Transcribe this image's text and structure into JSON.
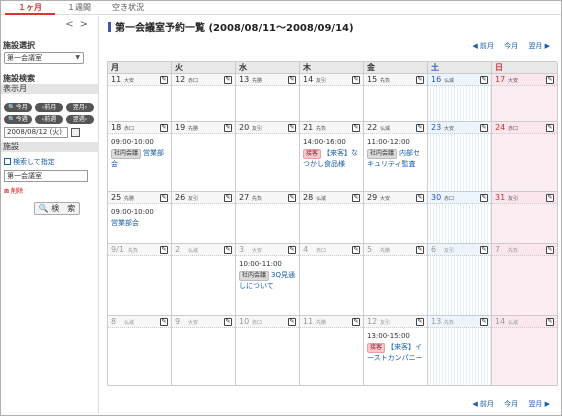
{
  "tabs": [
    "１ヶ月",
    "１週間",
    "空き状況"
  ],
  "sidebar": {
    "facility_select_heading": "施設選択",
    "facility_select_value": "第一会議室",
    "facility_search_heading": "施設検索",
    "display_month_label": "表示月",
    "today_button": "今月",
    "prev_month_button": "前月",
    "next_month_button": "翌月",
    "today_week_button": "今週",
    "prev_week_button": "前週",
    "next_week_button": "翌週",
    "date_value": "2008/08/12 (火)",
    "facility_label": "施設",
    "search_link": "検索して指定",
    "facility_input_value": "第一会議室",
    "delete_label": "削除",
    "search_button": "検　索"
  },
  "main": {
    "title": "第一会議室予約一覧 (2008/08/11～2008/09/14)",
    "pager_prev": "◀ 前月",
    "pager_current": "今月",
    "pager_next": "翌月 ▶"
  },
  "weekdays": [
    "月",
    "火",
    "水",
    "木",
    "金",
    "土",
    "日"
  ],
  "weeks": [
    [
      {
        "day": "11",
        "rokuyo": "大安",
        "events": []
      },
      {
        "day": "12",
        "rokuyo": "赤口",
        "events": []
      },
      {
        "day": "13",
        "rokuyo": "先勝",
        "events": []
      },
      {
        "day": "14",
        "rokuyo": "友引",
        "events": []
      },
      {
        "day": "15",
        "rokuyo": "先負",
        "events": []
      },
      {
        "day": "16",
        "rokuyo": "仏滅",
        "events": []
      },
      {
        "day": "17",
        "rokuyo": "大安",
        "events": []
      }
    ],
    [
      {
        "day": "18",
        "rokuyo": "赤口",
        "events": [
          {
            "time": "09:00-10:00",
            "tag": "社内会議",
            "tag_type": "internal",
            "title": "営業部会"
          }
        ]
      },
      {
        "day": "19",
        "rokuyo": "先勝",
        "events": []
      },
      {
        "day": "20",
        "rokuyo": "友引",
        "events": []
      },
      {
        "day": "21",
        "rokuyo": "先負",
        "events": [
          {
            "time": "14:00-16:00",
            "tag": "接客",
            "tag_type": "visitor",
            "title": "【来客】なつかし食品様"
          }
        ]
      },
      {
        "day": "22",
        "rokuyo": "仏滅",
        "events": [
          {
            "time": "11:00-12:00",
            "tag": "社内会議",
            "tag_type": "internal",
            "title": "内部セキュリティ監査"
          }
        ]
      },
      {
        "day": "23",
        "rokuyo": "大安",
        "events": []
      },
      {
        "day": "24",
        "rokuyo": "赤口",
        "events": []
      }
    ],
    [
      {
        "day": "25",
        "rokuyo": "先勝",
        "events": [
          {
            "time": "09:00-10:00",
            "tag": "",
            "tag_type": "",
            "title": "営業部会"
          }
        ]
      },
      {
        "day": "26",
        "rokuyo": "友引",
        "events": []
      },
      {
        "day": "27",
        "rokuyo": "先負",
        "events": []
      },
      {
        "day": "28",
        "rokuyo": "仏滅",
        "events": []
      },
      {
        "day": "29",
        "rokuyo": "大安",
        "events": []
      },
      {
        "day": "30",
        "rokuyo": "赤口",
        "events": []
      },
      {
        "day": "31",
        "rokuyo": "友引",
        "events": []
      }
    ],
    [
      {
        "day": "9/1",
        "rokuyo": "先負",
        "events": []
      },
      {
        "day": "2",
        "rokuyo": "仏滅",
        "events": []
      },
      {
        "day": "3",
        "rokuyo": "大安",
        "events": [
          {
            "time": "10:00-11:00",
            "tag": "社内会議",
            "tag_type": "internal",
            "title": "3Q見通しについて"
          }
        ]
      },
      {
        "day": "4",
        "rokuyo": "赤口",
        "events": []
      },
      {
        "day": "5",
        "rokuyo": "先勝",
        "events": []
      },
      {
        "day": "6",
        "rokuyo": "友引",
        "events": []
      },
      {
        "day": "7",
        "rokuyo": "先負",
        "events": []
      }
    ],
    [
      {
        "day": "8",
        "rokuyo": "仏滅",
        "events": []
      },
      {
        "day": "9",
        "rokuyo": "大安",
        "events": []
      },
      {
        "day": "10",
        "rokuyo": "赤口",
        "events": []
      },
      {
        "day": "11",
        "rokuyo": "先勝",
        "events": []
      },
      {
        "day": "12",
        "rokuyo": "友引",
        "events": [
          {
            "time": "13:00-15:00",
            "tag": "接客",
            "tag_type": "visitor",
            "title": "【来客】イーストカンパニー"
          }
        ]
      },
      {
        "day": "13",
        "rokuyo": "先負",
        "events": []
      },
      {
        "day": "14",
        "rokuyo": "仏滅",
        "events": []
      }
    ]
  ],
  "colors": {
    "accent_red": "#d03030",
    "saturday_blue": "#2850c8",
    "link_blue": "#1a5dab"
  }
}
